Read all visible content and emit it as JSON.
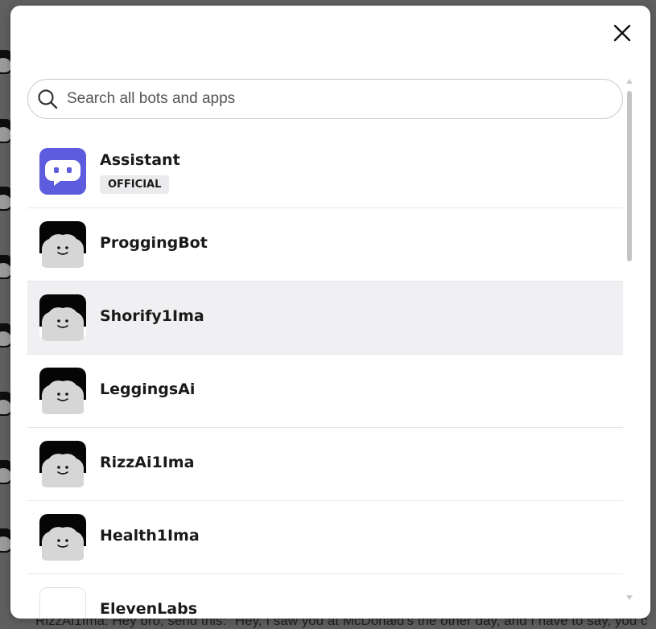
{
  "background": {
    "chat_text": "RizzAi1Ima: Hey bro, send this: \"Hey, I saw you at McDonald's the other day, and I have to say, you c"
  },
  "modal": {
    "close_icon": "close-icon",
    "search": {
      "placeholder": "Search all bots and apps",
      "value": "",
      "icon": "search-icon"
    },
    "bots": [
      {
        "name": "Assistant",
        "badge": "OFFICIAL",
        "avatar": "assistant-chat-icon",
        "highlighted": false
      },
      {
        "name": "ProggingBot",
        "avatar": "default-avatar",
        "highlighted": false
      },
      {
        "name": "Shorify1Ima",
        "avatar": "default-avatar",
        "highlighted": true
      },
      {
        "name": "LeggingsAi",
        "avatar": "default-avatar",
        "highlighted": false
      },
      {
        "name": "RizzAi1Ima",
        "avatar": "default-avatar",
        "highlighted": false
      },
      {
        "name": "Health1Ima",
        "avatar": "default-avatar",
        "highlighted": false
      },
      {
        "name": "ElevenLabs",
        "avatar": "elevenlabs-avatar",
        "highlighted": false
      }
    ],
    "colors": {
      "assistant_avatar_bg": "#5d5cde",
      "highlight_bg": "#f0f0f2",
      "backdrop": "#5f5f5f"
    }
  }
}
